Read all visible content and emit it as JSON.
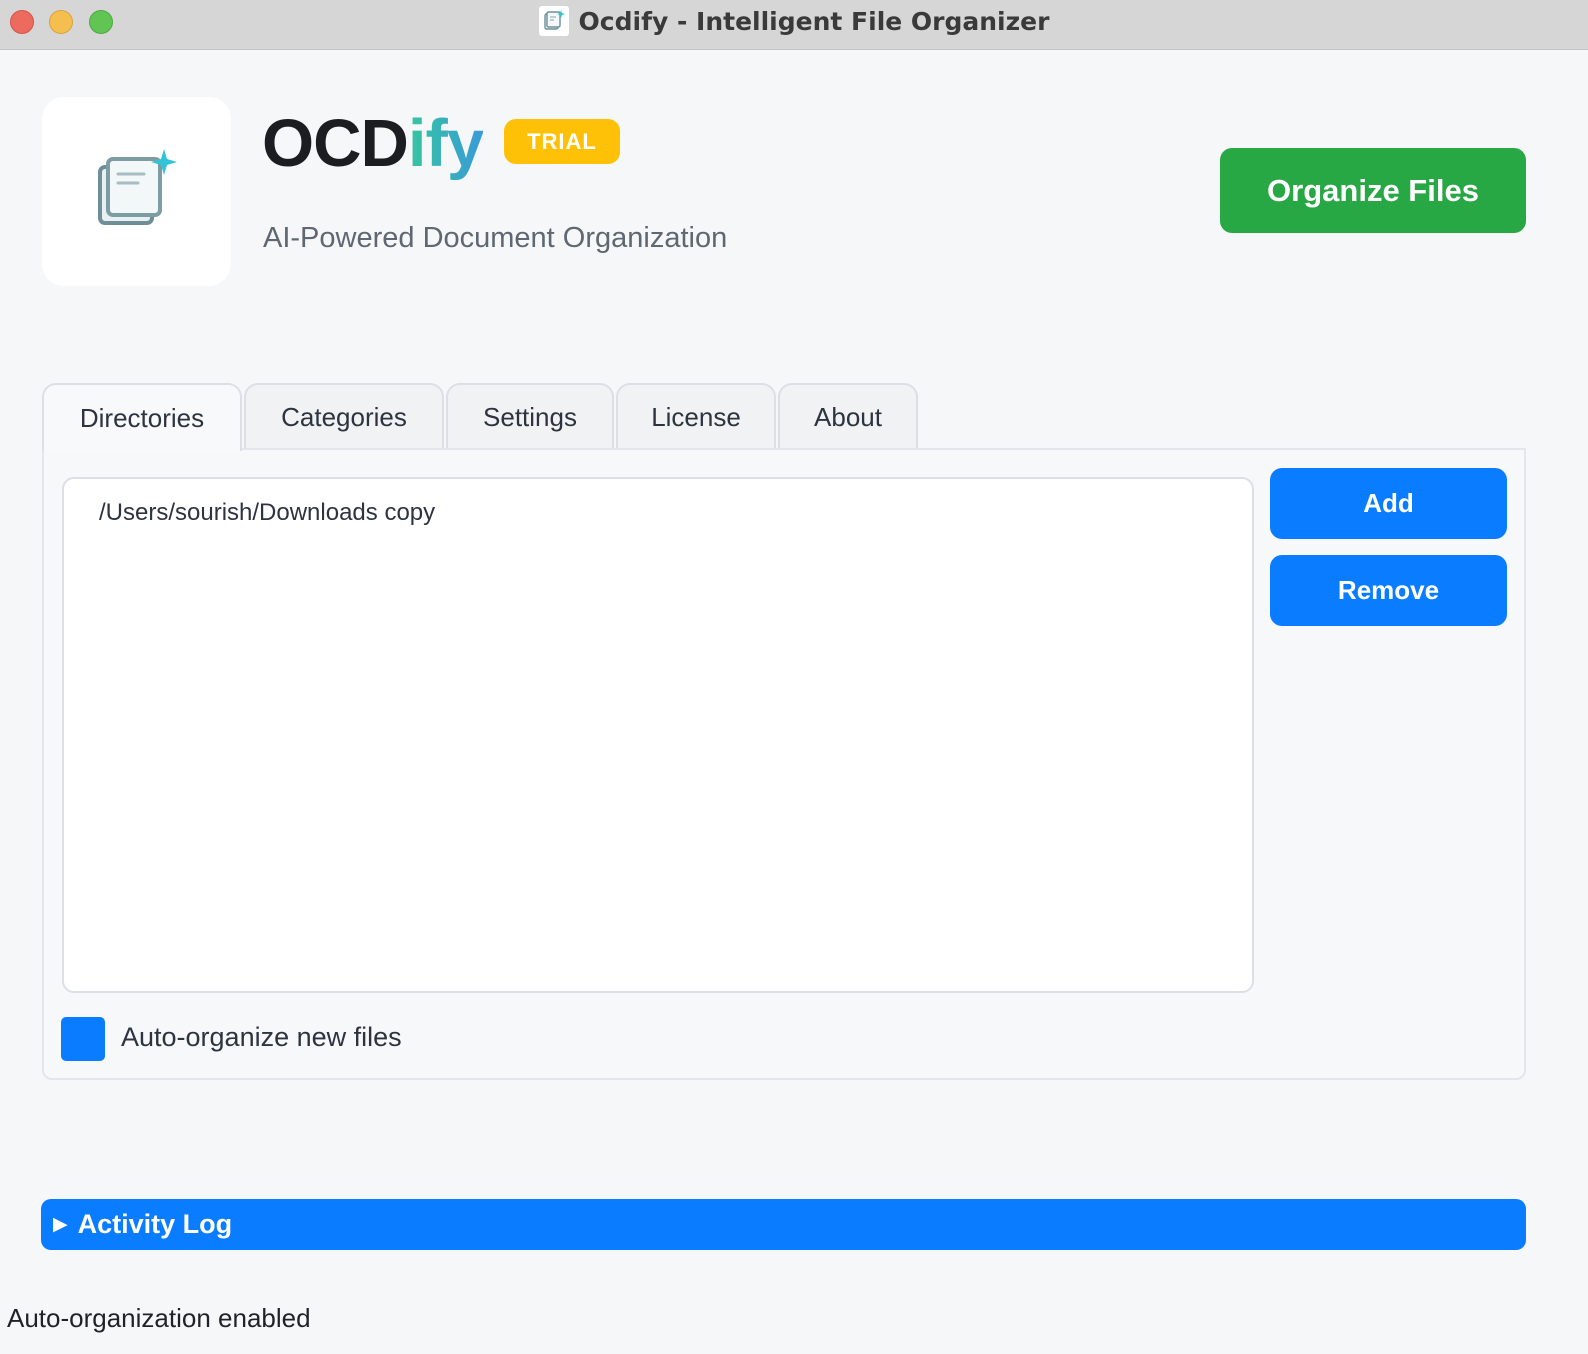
{
  "window": {
    "title": "Ocdify - Intelligent File Organizer",
    "icon": "document-sparkle-icon"
  },
  "header": {
    "brand_part1": "OCD",
    "brand_part2": "ify",
    "badge": "TRIAL",
    "subtitle": "AI-Powered Document Organization",
    "organize_label": "Organize Files",
    "logo_icon": "document-sparkle-icon"
  },
  "tabs": [
    {
      "label": "Directories",
      "active": true
    },
    {
      "label": "Categories",
      "active": false
    },
    {
      "label": "Settings",
      "active": false
    },
    {
      "label": "License",
      "active": false
    },
    {
      "label": "About",
      "active": false
    }
  ],
  "directories": {
    "items": [
      "/Users/sourish/Downloads copy"
    ],
    "add_label": "Add",
    "remove_label": "Remove",
    "auto_organize_label": "Auto-organize new files",
    "auto_organize_checked": true
  },
  "activity_log": {
    "label": "Activity Log",
    "expanded": false
  },
  "status": {
    "text": "Auto-organization enabled"
  },
  "colors": {
    "primary_blue": "#0a7cff",
    "organize_green": "#28a745",
    "trial_yellow": "#ffc107",
    "background": "#f6f7f9"
  }
}
